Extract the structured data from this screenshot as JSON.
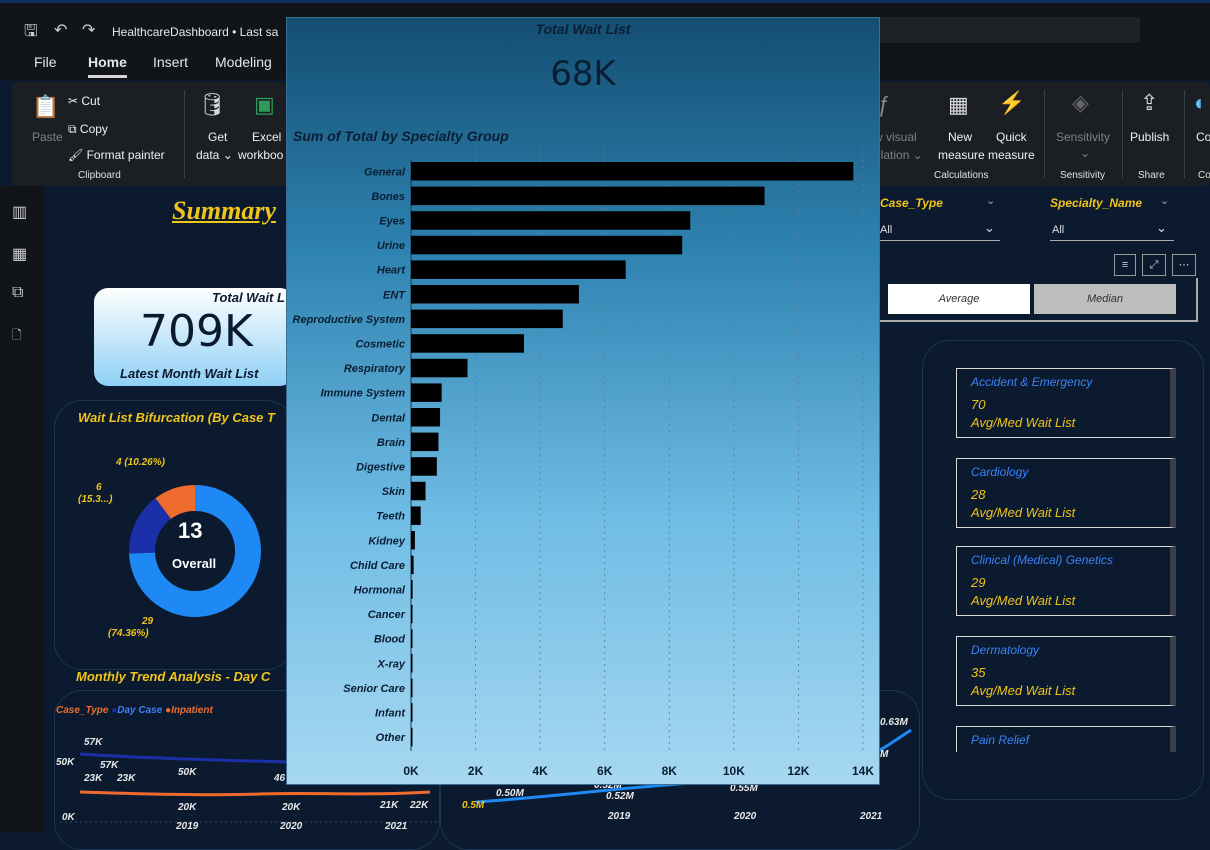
{
  "window": {
    "title": "HealthcareDashboard • Last sa",
    "icons": [
      "save-icon",
      "undo-icon",
      "redo-icon"
    ]
  },
  "menu": {
    "items": [
      "File",
      "Home",
      "Insert",
      "Modeling"
    ],
    "active": "Home"
  },
  "ribbon": {
    "cut": "Cut",
    "copy": "Copy",
    "format_painter": "Format painter",
    "paste": "Paste",
    "clipboard": "Clipboard",
    "get_data": "Get",
    "get_data2": "data ⌄",
    "excel": "Excel",
    "excel2": "workboo",
    "new_visual": "w visual",
    "calculation": "ulation ⌄",
    "new_measure": "New",
    "new_measure2": "measure",
    "quick_measure": "Quick",
    "quick_measure2": "measure",
    "calculations": "Calculations",
    "sensitivity": "Sensitivity",
    "sensitivity_dd": "⌄",
    "sensitivity_group": "Sensitivity",
    "publish": "Publish",
    "share": "Share",
    "co": "Co",
    "co2": "Co"
  },
  "dashboard": {
    "summary_title": "Summary",
    "kpi": {
      "title": "Total Wait L",
      "value": "709K",
      "subtitle": "Latest Month Wait List"
    },
    "bifurcation_title": "Wait List Bifurcation (By Case T",
    "donut": {
      "center_value": "13",
      "center_label": "Overall",
      "segments": [
        {
          "label": "4 (10.26%)",
          "value": 4,
          "color": "#ef6c2e"
        },
        {
          "label": "6",
          "label2": "(15.3...)",
          "value": 6,
          "color": "#1b2fa8"
        },
        {
          "label": "29",
          "label2": "(74.36%)",
          "value": 29,
          "color": "#1e88f5"
        }
      ]
    },
    "trend_title": "Monthly Trend Analysis - Day C",
    "legend": {
      "title": "Case_Type",
      "day": "Day Case",
      "inp": "Inpatient"
    },
    "trend_labels": [
      "57K",
      "57K",
      "50K",
      "23K",
      "23K",
      "20K",
      "20K",
      "21K",
      "22K",
      "46",
      "50K",
      "0K"
    ],
    "trend_years": [
      "2019",
      "2020",
      "2021"
    ],
    "trend2_labels": [
      "0.50M",
      "0.52M",
      "0.52M",
      "0.55M",
      "0.63M",
      "M",
      "0.5M"
    ],
    "trend2_years": [
      "2019",
      "2020",
      "2021"
    ],
    "slicers": {
      "case_type": {
        "title": "Case_Type",
        "value": "All"
      },
      "specialty": {
        "title": "Specialty_Name",
        "value": "All"
      }
    },
    "toggle": {
      "average": "Average",
      "median": "Median"
    },
    "specialty_cards": [
      {
        "name": "Accident & Emergency",
        "value": "70",
        "label": "Avg/Med Wait List"
      },
      {
        "name": "Cardiology",
        "value": "28",
        "label": "Avg/Med Wait List"
      },
      {
        "name": "Clinical (Medical) Genetics",
        "value": "29",
        "label": "Avg/Med Wait List"
      },
      {
        "name": "Dermatology",
        "value": "35",
        "label": "Avg/Med Wait List"
      },
      {
        "name": "Pain Relief",
        "value": "",
        "label": ""
      }
    ]
  },
  "popup": {
    "title": "Total Wait List",
    "value": "68K"
  },
  "chart_data": {
    "type": "bar",
    "orientation": "horizontal",
    "title": "Sum of Total by Specialty Group",
    "categories": [
      "General",
      "Bones",
      "Eyes",
      "Urine",
      "Heart",
      "ENT",
      "Reproductive System",
      "Cosmetic",
      "Respiratory",
      "Immune System",
      "Dental",
      "Brain",
      "Digestive",
      "Skin",
      "Teeth",
      "Kidney",
      "Child Care",
      "Hormonal",
      "Cancer",
      "Blood",
      "X-ray",
      "Senior Care",
      "Infant",
      "Other"
    ],
    "values": [
      13700,
      10950,
      8650,
      8400,
      6650,
      5200,
      4700,
      3500,
      1750,
      950,
      900,
      850,
      800,
      450,
      300,
      120,
      80,
      50,
      40,
      30,
      20,
      15,
      10,
      5
    ],
    "xlim": [
      0,
      14000
    ],
    "xticks": [
      "0K",
      "2K",
      "4K",
      "6K",
      "8K",
      "10K",
      "12K",
      "14K"
    ],
    "grid": true,
    "bar_color": "#000000"
  }
}
